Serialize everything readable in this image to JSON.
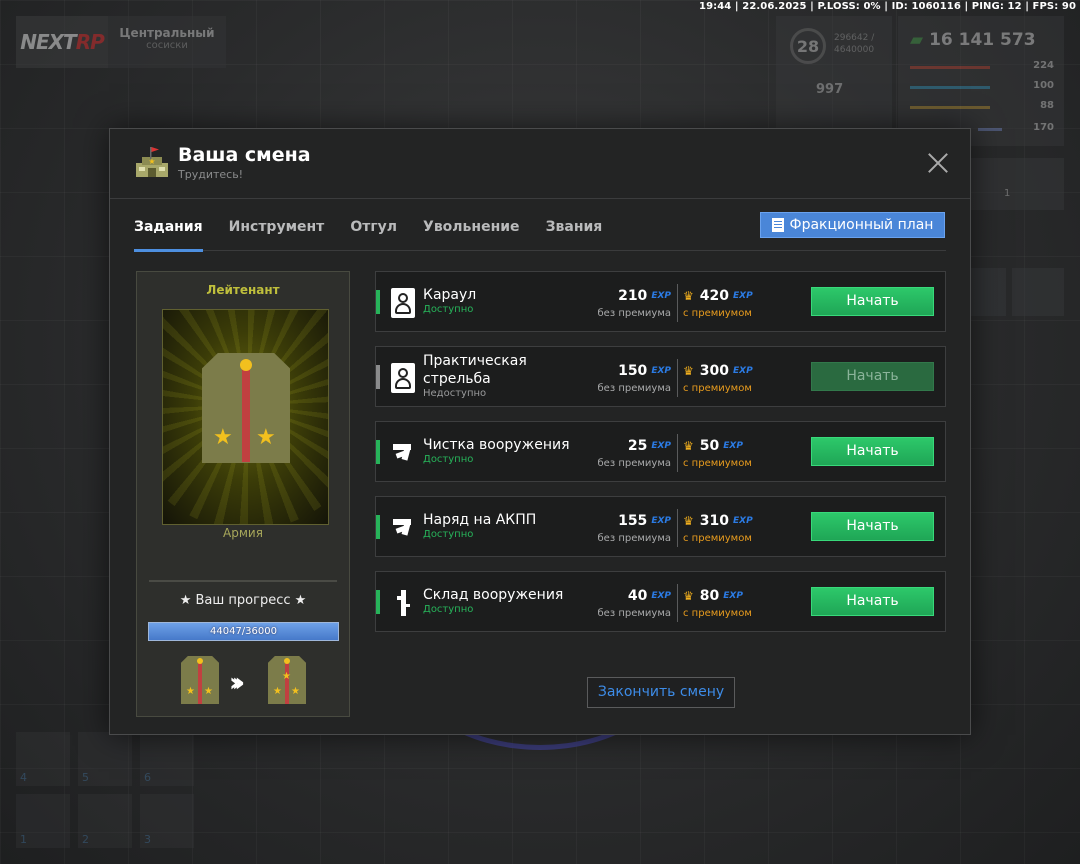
{
  "hud": {
    "status_line": "19:44 | 22.06.2025 | P.LOSS: 0% | ID: 1060116 | PING: 12 | FPS: 90",
    "logo_main": "NEXT",
    "logo_accent": "RP",
    "server_name": "Центральный",
    "server_sub": "сосиски",
    "level": "28",
    "level_xp": "296642 / 4640000",
    "likes": "997",
    "money": "16 141 573",
    "stats": [
      {
        "value": "224",
        "color": "#c94b3a"
      },
      {
        "value": "100",
        "color": "#3aa0c9"
      },
      {
        "value": "88",
        "color": "#c9a03a"
      },
      {
        "value": "170",
        "color": "#7a8fcf"
      }
    ],
    "slot_count": "1",
    "inventory_slots": [
      "4",
      "5",
      "6",
      "1",
      "2",
      "3"
    ]
  },
  "modal": {
    "title": "Ваша смена",
    "subtitle": "Трудитесь!",
    "tabs": [
      "Задания",
      "Инструмент",
      "Отгул",
      "Увольнение",
      "Звания"
    ],
    "active_tab": 0,
    "plan_button": "Фракционный план",
    "finish_button": "Закончить смену"
  },
  "rank": {
    "name": "Лейтенант",
    "branch": "Армия",
    "progress_label": "★ Ваш прогресс ★",
    "progress_text": "44047/36000",
    "progress_fraction": 1.0
  },
  "tasks": [
    {
      "name": "Караул",
      "name2": "",
      "status": "Доступно",
      "available": true,
      "exp": "210",
      "exp_premium": "420",
      "icon": "target-icon"
    },
    {
      "name": "Практическая",
      "name2": "стрельба",
      "status": "Недоступно",
      "available": false,
      "exp": "150",
      "exp_premium": "300",
      "icon": "target-icon"
    },
    {
      "name": "Чистка вооружения",
      "name2": "",
      "status": "Доступно",
      "available": true,
      "exp": "25",
      "exp_premium": "50",
      "icon": "pistol-icon"
    },
    {
      "name": "Наряд на АКПП",
      "name2": "",
      "status": "Доступно",
      "available": true,
      "exp": "155",
      "exp_premium": "310",
      "icon": "pistol-icon"
    },
    {
      "name": "Склад вооружения",
      "name2": "",
      "status": "Доступно",
      "available": true,
      "exp": "40",
      "exp_premium": "80",
      "icon": "rifle-icon"
    }
  ],
  "labels": {
    "exp_unit": "EXP",
    "no_premium": "без премиума",
    "with_premium": "с премиумом",
    "start": "Начать"
  }
}
